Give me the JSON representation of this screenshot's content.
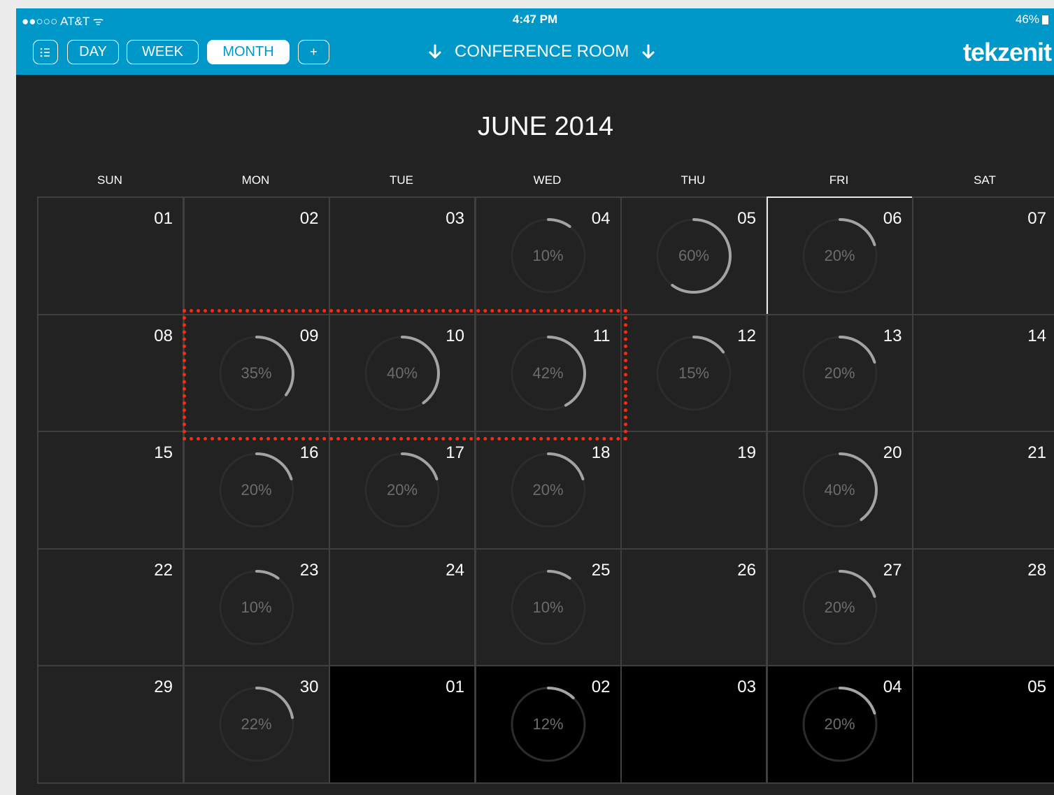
{
  "status_bar": {
    "carrier": "●●○○○ AT&T ᯤ",
    "time": "4:47 PM",
    "battery": "46%"
  },
  "toolbar": {
    "list_icon": "list-icon",
    "day_label": "DAY",
    "week_label": "WEEK",
    "month_label": "MONTH",
    "add_label": "+",
    "active_view": "MONTH",
    "room_label": "CONFERENCE ROOM",
    "logo": "tekzenit"
  },
  "calendar": {
    "title": "JUNE 2014",
    "weekdays": [
      "SUN",
      "MON",
      "TUE",
      "WED",
      "THU",
      "FRI",
      "SAT"
    ],
    "selected_day": "06",
    "weeks": [
      [
        {
          "day": "01"
        },
        {
          "day": "02"
        },
        {
          "day": "03"
        },
        {
          "day": "04",
          "pct": "10%",
          "value": 10
        },
        {
          "day": "05",
          "pct": "60%",
          "value": 60
        },
        {
          "day": "06",
          "pct": "20%",
          "value": 20,
          "selected": true
        },
        {
          "day": "07"
        }
      ],
      [
        {
          "day": "08"
        },
        {
          "day": "09",
          "pct": "35%",
          "value": 35
        },
        {
          "day": "10",
          "pct": "40%",
          "value": 40
        },
        {
          "day": "11",
          "pct": "42%",
          "value": 42
        },
        {
          "day": "12",
          "pct": "15%",
          "value": 15
        },
        {
          "day": "13",
          "pct": "20%",
          "value": 20
        },
        {
          "day": "14"
        }
      ],
      [
        {
          "day": "15"
        },
        {
          "day": "16",
          "pct": "20%",
          "value": 20
        },
        {
          "day": "17",
          "pct": "20%",
          "value": 20
        },
        {
          "day": "18",
          "pct": "20%",
          "value": 20
        },
        {
          "day": "19"
        },
        {
          "day": "20",
          "pct": "40%",
          "value": 40
        },
        {
          "day": "21"
        }
      ],
      [
        {
          "day": "22"
        },
        {
          "day": "23",
          "pct": "10%",
          "value": 10
        },
        {
          "day": "24"
        },
        {
          "day": "25",
          "pct": "10%",
          "value": 10
        },
        {
          "day": "26"
        },
        {
          "day": "27",
          "pct": "20%",
          "value": 20
        },
        {
          "day": "28"
        }
      ],
      [
        {
          "day": "29"
        },
        {
          "day": "30",
          "pct": "22%",
          "value": 22
        },
        {
          "day": "01",
          "other": true
        },
        {
          "day": "02",
          "pct": "12%",
          "value": 12,
          "other": true
        },
        {
          "day": "03",
          "other": true
        },
        {
          "day": "04",
          "pct": "20%",
          "value": 20,
          "other": true
        },
        {
          "day": "05",
          "other": true
        }
      ]
    ]
  },
  "colors": {
    "brand": "#0098c8",
    "background": "#222222",
    "ring_track": "#2c2c2c",
    "ring_progress": "#a3a3a3",
    "highlight": "#ff2a0a"
  }
}
